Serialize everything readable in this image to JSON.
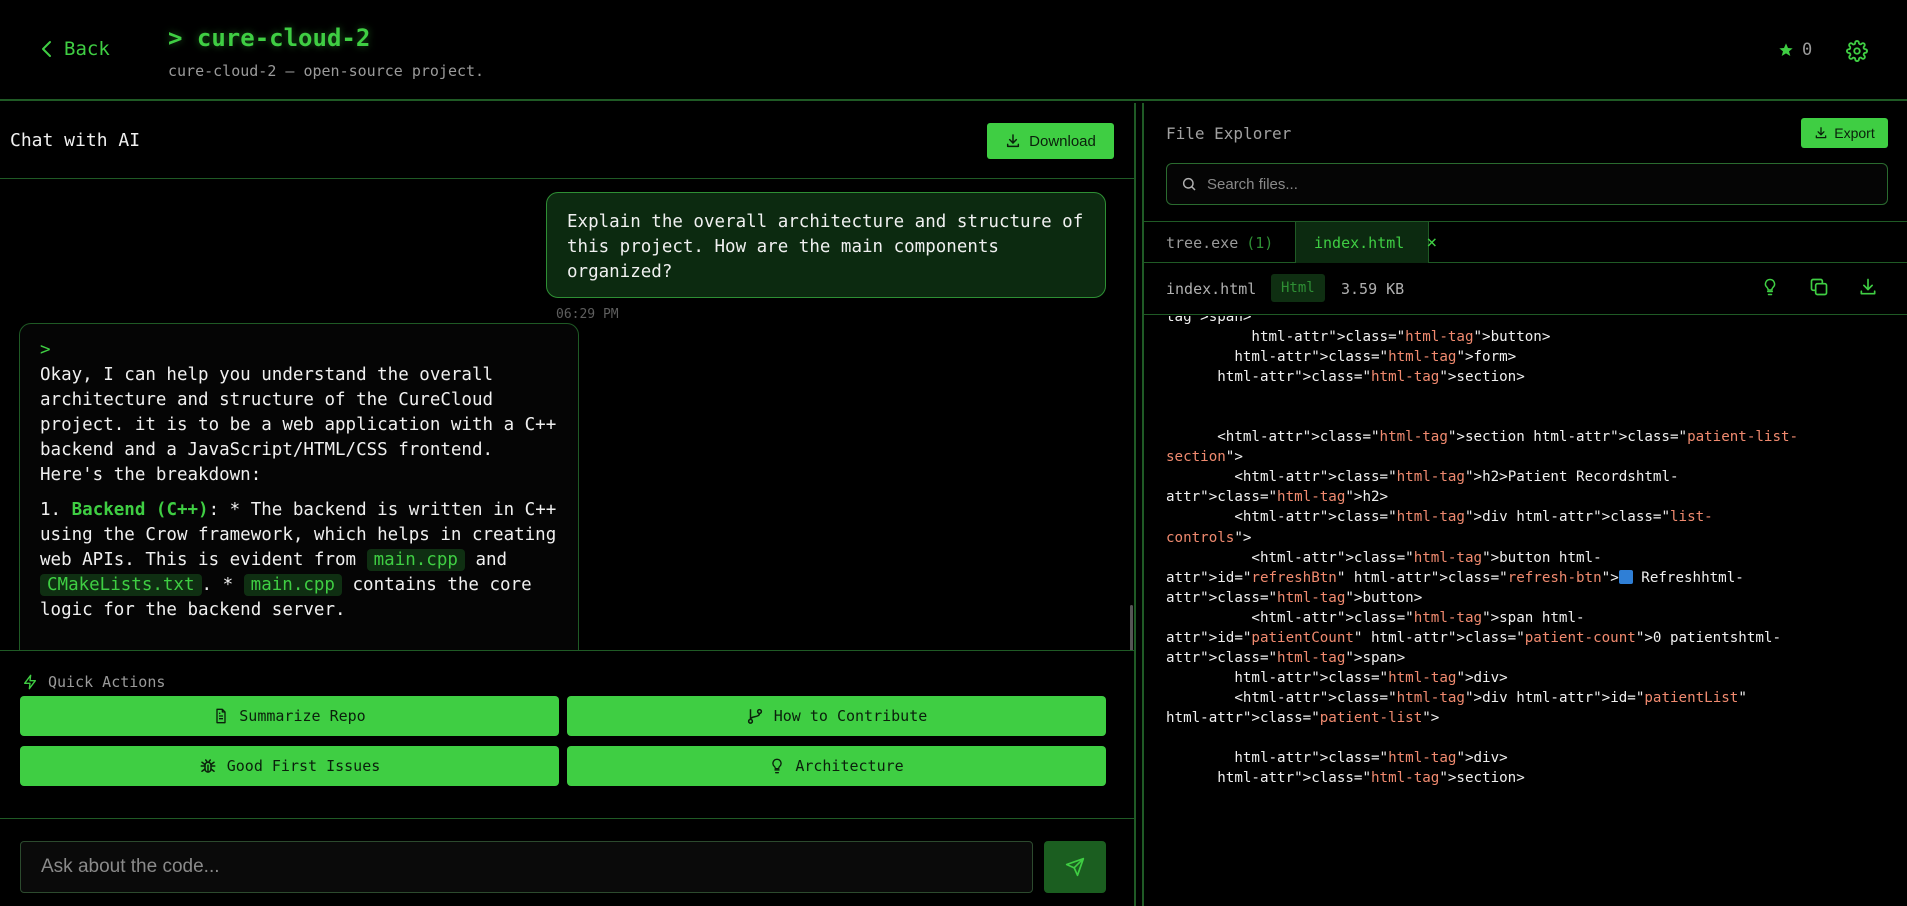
{
  "header": {
    "back_label": "Back",
    "title": "> cure-cloud-2",
    "subtitle": "cure-cloud-2 — open-source project.",
    "star_count": "0"
  },
  "chat": {
    "title": "Chat with AI",
    "download_label": "Download",
    "user_message": "Explain the overall architecture and structure of this project. How are the main components organized?",
    "user_time": "06:29 PM",
    "ai_prompt": ">",
    "ai_intro": "Okay, I can help you understand the overall architecture and structure of the CureCloud project. it is to be a web application with a C++ backend and a JavaScript/HTML/CSS frontend. Here's the breakdown:",
    "ai_point": {
      "number": "1.",
      "heading": "Backend (C++)",
      "text1": ": * The backend is written in C++ using the Crow framework, which helps in creating web APIs. This is evident from",
      "code1": "main.cpp",
      "and": "and",
      "code2": "CMakeLists.txt",
      "text2": ". *",
      "code3": "main.cpp",
      "text3": "contains the core logic for the backend server."
    }
  },
  "quick_actions": {
    "label": "Quick Actions",
    "buttons": [
      "Summarize Repo",
      "How to Contribute",
      "Good First Issues",
      "Architecture"
    ]
  },
  "input": {
    "placeholder": "Ask about the code..."
  },
  "explorer": {
    "title": "File Explorer",
    "export_label": "Export",
    "search_placeholder": "Search files...",
    "tabs": [
      {
        "label": "tree.exe",
        "count": "(1)"
      },
      {
        "label": "index.html",
        "close": "×"
      }
    ],
    "file": {
      "name": "index.html",
      "type": "Html",
      "size": "3.59 KB"
    }
  },
  "code_lines": [
    {
      "i": "",
      "t": [
        [
          "tag\">span>",
          ""
        ]
      ]
    },
    {
      "i": "          ",
      "t": [
        [
          "html-attr\">class=\"",
          ""
        ],
        [
          "html-tag",
          "s"
        ],
        [
          "\">button>",
          ""
        ]
      ]
    },
    {
      "i": "        ",
      "t": [
        [
          "html-attr\">class=\"",
          ""
        ],
        [
          "html-tag",
          "s"
        ],
        [
          "\">form>",
          ""
        ]
      ]
    },
    {
      "i": "      ",
      "t": [
        [
          "html-attr\">class=\"",
          ""
        ],
        [
          "html-tag",
          "s"
        ],
        [
          "\">section>",
          ""
        ]
      ]
    },
    {
      "i": "",
      "t": []
    },
    {
      "i": "",
      "t": []
    },
    {
      "i": "      ",
      "t": [
        [
          "<html-attr\">class=\"",
          ""
        ],
        [
          "html-tag",
          "s"
        ],
        [
          "\">section html-attr\">class=\"",
          ""
        ],
        [
          "patient-list-",
          "s"
        ]
      ]
    },
    {
      "i": "",
      "t": [
        [
          "section",
          "s"
        ],
        [
          "\">",
          ""
        ]
      ]
    },
    {
      "i": "        ",
      "t": [
        [
          "<html-attr\">class=\"",
          ""
        ],
        [
          "html-tag",
          "s"
        ],
        [
          "\">h2>Patient Recordshtml-",
          ""
        ]
      ]
    },
    {
      "i": "",
      "t": [
        [
          "attr\">class=\"",
          ""
        ],
        [
          "html-tag",
          "s"
        ],
        [
          "\">h2>",
          ""
        ]
      ]
    },
    {
      "i": "        ",
      "t": [
        [
          "<html-attr\">class=\"",
          ""
        ],
        [
          "html-tag",
          "s"
        ],
        [
          "\">div html-attr\">class=\"",
          ""
        ],
        [
          "list-",
          "s"
        ]
      ]
    },
    {
      "i": "",
      "t": [
        [
          "controls",
          "s"
        ],
        [
          "\">",
          ""
        ]
      ]
    },
    {
      "i": "          ",
      "t": [
        [
          "<html-attr\">class=\"",
          ""
        ],
        [
          "html-tag",
          "s"
        ],
        [
          "\">button html-",
          ""
        ]
      ]
    },
    {
      "i": "",
      "t": [
        [
          "attr\">id=\"",
          ""
        ],
        [
          "refreshBtn",
          "s"
        ],
        [
          "\" html-attr\">class=\"",
          ""
        ],
        [
          "refresh-btn",
          "s"
        ],
        [
          "\">",
          ""
        ],
        [
          "",
          "emoji"
        ],
        [
          " Refreshhtml-",
          ""
        ]
      ]
    },
    {
      "i": "",
      "t": [
        [
          "attr\">class=\"",
          ""
        ],
        [
          "html-tag",
          "s"
        ],
        [
          "\">button>",
          ""
        ]
      ]
    },
    {
      "i": "          ",
      "t": [
        [
          "<html-attr\">class=\"",
          ""
        ],
        [
          "html-tag",
          "s"
        ],
        [
          "\">span html-",
          ""
        ]
      ]
    },
    {
      "i": "",
      "t": [
        [
          "attr\">id=\"",
          ""
        ],
        [
          "patientCount",
          "s"
        ],
        [
          "\" html-attr\">class=\"",
          ""
        ],
        [
          "patient-count",
          "s"
        ],
        [
          "\">0 patientshtml-",
          ""
        ]
      ]
    },
    {
      "i": "",
      "t": [
        [
          "attr\">class=\"",
          ""
        ],
        [
          "html-tag",
          "s"
        ],
        [
          "\">span>",
          ""
        ]
      ]
    },
    {
      "i": "        ",
      "t": [
        [
          "html-attr\">class=\"",
          ""
        ],
        [
          "html-tag",
          "s"
        ],
        [
          "\">div>",
          ""
        ]
      ]
    },
    {
      "i": "        ",
      "t": [
        [
          "<html-attr\">class=\"",
          ""
        ],
        [
          "html-tag",
          "s"
        ],
        [
          "\">div html-attr\">id=\"",
          ""
        ],
        [
          "patientList",
          "s"
        ],
        [
          "\"",
          ""
        ]
      ]
    },
    {
      "i": "",
      "t": [
        [
          "html-attr\">class=\"",
          ""
        ],
        [
          "patient-list",
          "s"
        ],
        [
          "\">",
          ""
        ]
      ]
    },
    {
      "i": "",
      "t": []
    },
    {
      "i": "        ",
      "t": [
        [
          "html-attr\">class=\"",
          ""
        ],
        [
          "html-tag",
          "s"
        ],
        [
          "\">div>",
          ""
        ]
      ]
    },
    {
      "i": "      ",
      "t": [
        [
          "html-attr\">class=\"",
          ""
        ],
        [
          "html-tag",
          "s"
        ],
        [
          "\">section>",
          ""
        ]
      ]
    }
  ],
  "colors": {
    "accent": "#3fce43",
    "accent_dark": "#1b5e20",
    "border": "#1f5a25",
    "string": "#f08a6f",
    "background": "#000000"
  },
  "icons": [
    "chevron-left-icon",
    "star-icon",
    "gear-icon",
    "download-icon",
    "zap-icon",
    "file-text-icon",
    "git-branch-icon",
    "bug-icon",
    "lightbulb-icon",
    "send-icon",
    "search-icon",
    "copy-icon",
    "close-icon"
  ]
}
